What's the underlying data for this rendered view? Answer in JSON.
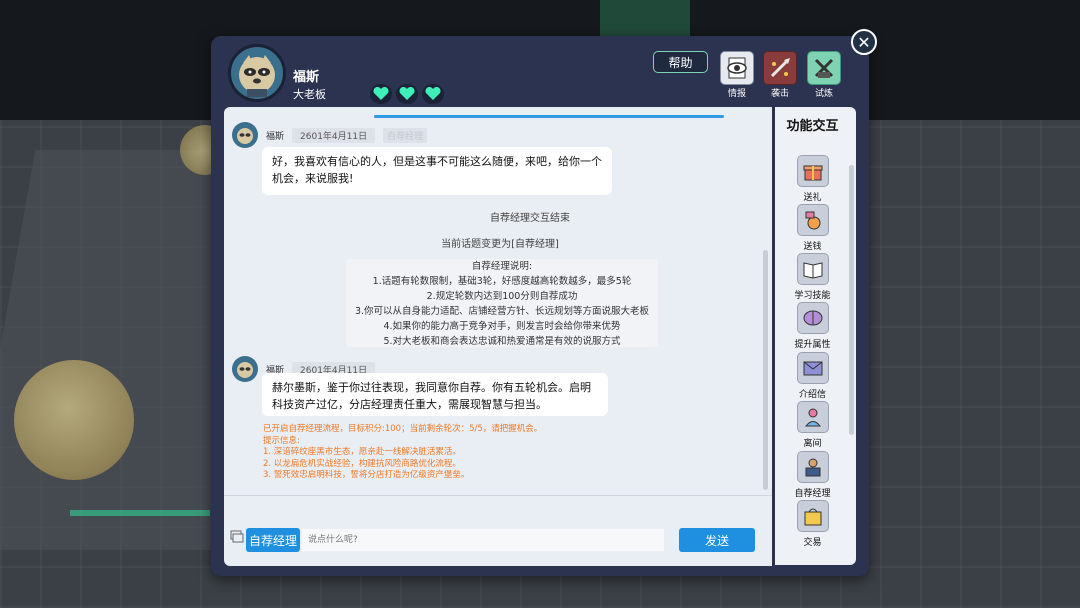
{
  "npc": {
    "name": "福斯",
    "title": "大老板"
  },
  "header": {
    "help_label": "帮助",
    "actions": [
      {
        "label": "情报",
        "icon": "eye-document-icon",
        "color": "#e6e9ef"
      },
      {
        "label": "袭击",
        "icon": "attack-icon",
        "color": "#8a3b3b"
      },
      {
        "label": "试炼",
        "icon": "trial-icon",
        "color": "#7fd3b2"
      }
    ],
    "hearts": 3
  },
  "chat": {
    "messages": [
      {
        "sender": "福斯",
        "date": "2601年4月11日",
        "topic": "自荐经理",
        "text": "好，我喜欢有信心的人，但是这事不可能这么随便，来吧，给你一个机会，来说服我!"
      },
      {
        "sender": "福斯",
        "date": "2601年4月11日",
        "text": "赫尔墨斯，鉴于你过往表现，我同意你自荐。你有五轮机会。启明科技资产过亿，分店经理责任重大，需展现智慧与担当。"
      }
    ],
    "system1": "自荐经理交互结束",
    "system2": "当前话题变更为[自荐经理]",
    "rules": {
      "title": "自荐经理说明:",
      "lines": [
        "1.话题有轮数限制，基础3轮，好感度越高轮数越多，最多5轮",
        "2.规定轮数内达到100分则自荐成功",
        "3.你可以从自身能力适配、店铺经营方针、长远规划等方面说服大老板",
        "4.如果你的能力高于竞争对手，则发言时会给你带来优势",
        "5.对大老板和商会表达忠诚和热爱通常是有效的说服方式"
      ]
    },
    "notice": {
      "line1": "已开启自荐经理流程，目标积分:100；当前剩余轮次：5/5，请把握机会。",
      "line2": "提示信息:",
      "tips": [
        "1. 深谙碎纹座黑市生态，愿亲赴一线解决脏活累活。",
        "2. 以龙扁危机实战经验，构建抗风险商路优化流程。",
        "3. 誓死效忠启明科技，誓将分店打造为亿级资产堡垒。"
      ]
    }
  },
  "input": {
    "topic_label": "自荐经理",
    "placeholder": "说点什么呢?",
    "send_label": "发送"
  },
  "side": {
    "title": "功能交互",
    "items": [
      {
        "label": "送礼",
        "icon": "gift-icon"
      },
      {
        "label": "送钱",
        "icon": "money-bag-icon"
      },
      {
        "label": "学习技能",
        "icon": "book-icon"
      },
      {
        "label": "提升属性",
        "icon": "brain-icon"
      },
      {
        "label": "介绍信",
        "icon": "envelope-icon"
      },
      {
        "label": "离间",
        "icon": "person-icon"
      },
      {
        "label": "自荐经理",
        "icon": "manager-icon"
      },
      {
        "label": "交易",
        "icon": "shopping-bag-icon"
      }
    ]
  },
  "colors": {
    "accent": "#1f8fe0",
    "panel": "#2b3350",
    "heart": "#3ef0b8",
    "notice": "#ef7a25"
  }
}
